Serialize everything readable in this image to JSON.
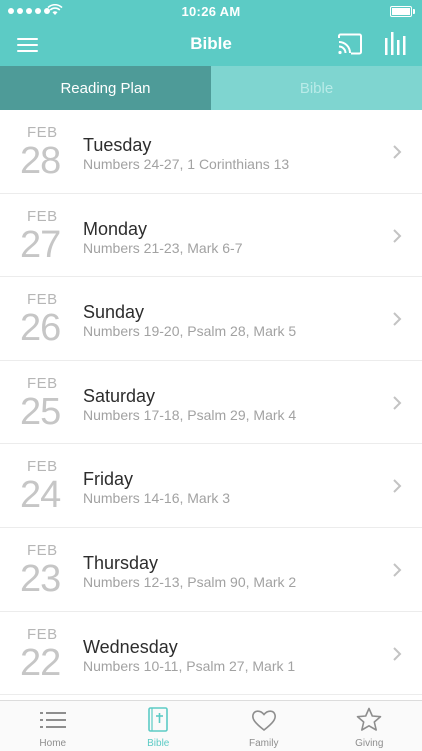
{
  "status_bar": {
    "time": "10:26 AM"
  },
  "navbar": {
    "title": "Bible",
    "icons": [
      "menu-icon",
      "cast-icon",
      "stats-icon"
    ]
  },
  "tabs": [
    {
      "label": "Reading Plan",
      "active": true
    },
    {
      "label": "Bible",
      "active": false
    }
  ],
  "readings": [
    {
      "month": "FEB",
      "day": "28",
      "weekday": "Tuesday",
      "passages": "Numbers 24-27, 1 Corinthians 13"
    },
    {
      "month": "FEB",
      "day": "27",
      "weekday": "Monday",
      "passages": "Numbers 21-23, Mark 6-7"
    },
    {
      "month": "FEB",
      "day": "26",
      "weekday": "Sunday",
      "passages": "Numbers 19-20, Psalm 28, Mark 5"
    },
    {
      "month": "FEB",
      "day": "25",
      "weekday": "Saturday",
      "passages": "Numbers 17-18, Psalm 29, Mark 4"
    },
    {
      "month": "FEB",
      "day": "24",
      "weekday": "Friday",
      "passages": "Numbers 14-16, Mark 3"
    },
    {
      "month": "FEB",
      "day": "23",
      "weekday": "Thursday",
      "passages": "Numbers 12-13, Psalm 90, Mark 2"
    },
    {
      "month": "FEB",
      "day": "22",
      "weekday": "Wednesday",
      "passages": "Numbers 10-11, Psalm 27, Mark 1"
    }
  ],
  "tabbar": [
    {
      "label": "Home",
      "icon": "list-icon",
      "active": false
    },
    {
      "label": "Bible",
      "icon": "bible-icon",
      "active": true
    },
    {
      "label": "Family",
      "icon": "heart-icon",
      "active": false
    },
    {
      "label": "Giving",
      "icon": "star-icon",
      "active": false
    }
  ],
  "colors": {
    "accent": "#5ccbc5",
    "tab_active_bg": "#4e9b98",
    "tab_inactive_bg": "#7fd5d0"
  }
}
